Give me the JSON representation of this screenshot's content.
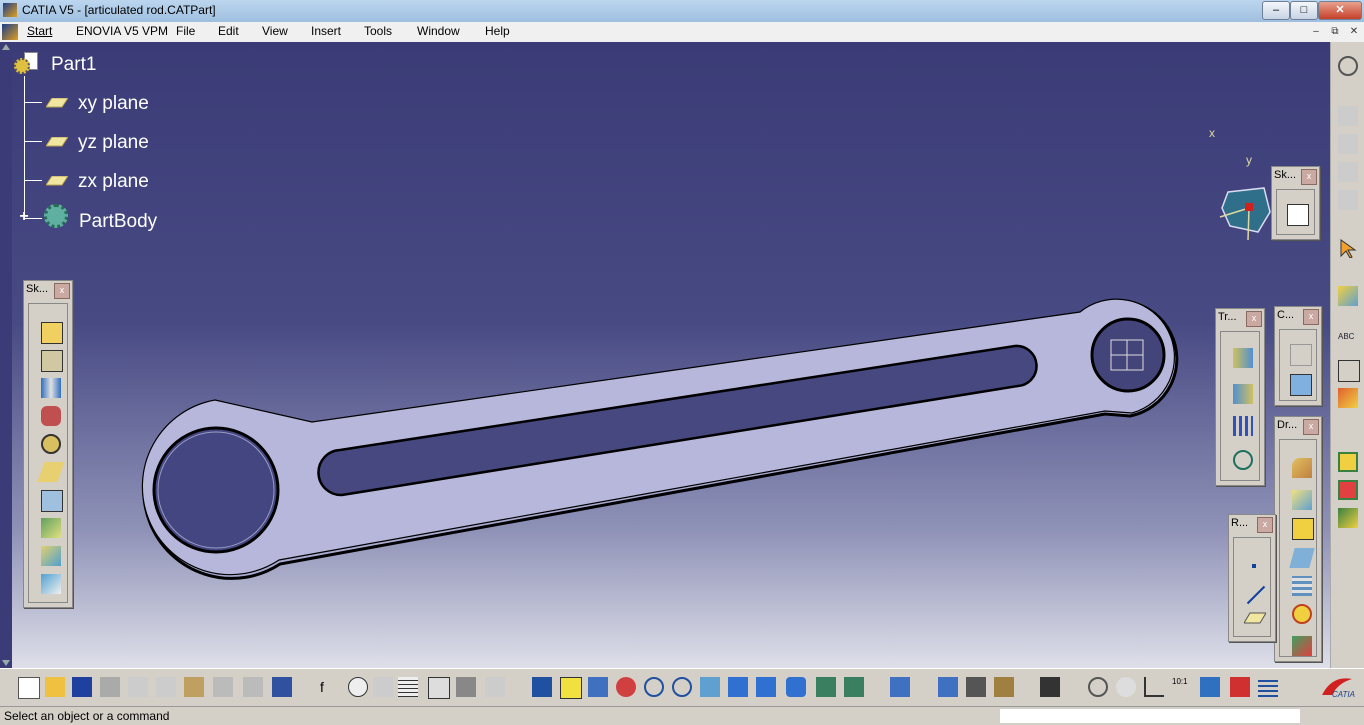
{
  "window": {
    "title": "CATIA V5 - [articulated rod.CATPart]",
    "min_label": "–",
    "max_label": "□",
    "close_label": "✕"
  },
  "menu": {
    "items": [
      "Start",
      "ENOVIA V5 VPM",
      "File",
      "Edit",
      "View",
      "Insert",
      "Tools",
      "Window",
      "Help"
    ],
    "doc_min": "–",
    "doc_restore": "⧉",
    "doc_close": "✕"
  },
  "tree": {
    "root": "Part1",
    "planes": [
      "xy plane",
      "yz plane",
      "zx plane"
    ],
    "body": "PartBody"
  },
  "compass": {
    "x": "x",
    "y": "y"
  },
  "panels": {
    "sketch_left": "Sk...",
    "sketch_right": "Sk...",
    "transform": "Tr...",
    "constraints": "C...",
    "dress_up": "Dr...",
    "reference": "R...",
    "close_glyph": "x"
  },
  "status": {
    "text": "Select an object or a command"
  },
  "colors": {
    "viewport_top": "#3b3c77",
    "viewport_bottom": "#dedfe9",
    "part_fill": "#a9aad0",
    "part_outline": "#000000",
    "tree_text": "#ffffff"
  },
  "icons": {
    "bottom_toolbar": [
      "new-icon",
      "open-icon",
      "save-icon",
      "print-icon",
      "cut-icon",
      "copy-icon",
      "paste-icon",
      "undo-icon",
      "redo-icon",
      "whats-this-icon",
      "formula-icon",
      "comment-icon",
      "knowledge-icon",
      "table-icon",
      "graph-icon",
      "lock-icon",
      "catalog-icon",
      "fly-mode-icon",
      "fit-all-icon",
      "pan-icon",
      "rotate-icon",
      "zoom-in-icon",
      "zoom-out-icon",
      "normal-view-icon",
      "multi-view-icon",
      "iso-view-icon",
      "shading-icon",
      "hide-show-icon",
      "swap-space-icon",
      "measure-icon",
      "measure-between-icon",
      "apply-material-icon",
      "mass-icon",
      "capture-icon",
      "update-icon",
      "hand-icon",
      "axis-icon",
      "scale-icon",
      "3d-icon",
      "error-icon",
      "list-icon"
    ]
  }
}
